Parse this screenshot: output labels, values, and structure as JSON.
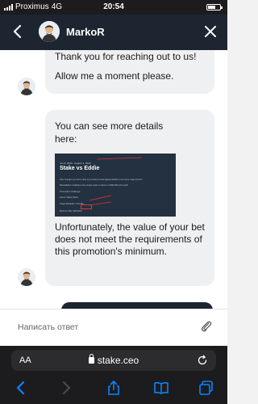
{
  "status": {
    "carrier": "Proximus",
    "network": "4G",
    "time": "20:54"
  },
  "header": {
    "agent_name": "MarkoR"
  },
  "messages": {
    "m1_line1": "Thank you for reaching out to us!",
    "m1_line2": "Allow me a moment please.",
    "m2_intro": "You can see more details here:",
    "m2_body": "Unfortunately, the value of your bet does not meet the requirements of this promotion's minimum."
  },
  "promo_image": {
    "date": "Jun 8, 2023 - August 1, 2023",
    "title": "Stake vs Eddie",
    "lines": [
      "Ever thought your bet is able to go head to head against Eddie to win some major prizes?",
      "Beat Eddie's multiplier every single week to share in a $50,000 prize pool!",
      "This week's challenge:",
      "Game: Wacky Bees",
      "Target Multiplier: 6,81.25x",
      "Minimum Bet: $30.0000"
    ]
  },
  "input": {
    "placeholder": "Написать ответ"
  },
  "browser": {
    "aa": "AA",
    "url": "stake.ceo"
  },
  "colors": {
    "header_bg": "#1c2530",
    "bubble_bg": "#eef0f2",
    "browser_accent": "#0a84ff"
  }
}
